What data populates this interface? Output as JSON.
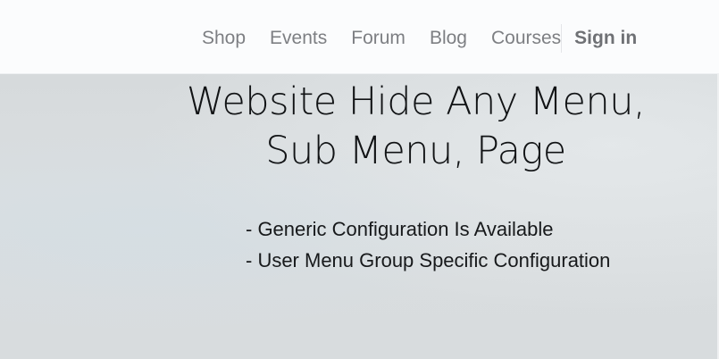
{
  "nav": {
    "items": [
      {
        "label": "Shop"
      },
      {
        "label": "Events"
      },
      {
        "label": "Forum"
      },
      {
        "label": "Blog"
      },
      {
        "label": "Courses"
      }
    ],
    "signin_label": "Sign in"
  },
  "hero": {
    "title_line1": "Website Hide Any Menu,",
    "title_line2": "Sub Menu, Page",
    "features": [
      "- Generic Configuration Is Available",
      "- User Menu Group Specific Configuration"
    ]
  },
  "colors": {
    "nav_background": "#fbfcfd",
    "nav_text": "#7d7f83",
    "hero_background": "#d8dcde",
    "hero_text": "#111315"
  }
}
